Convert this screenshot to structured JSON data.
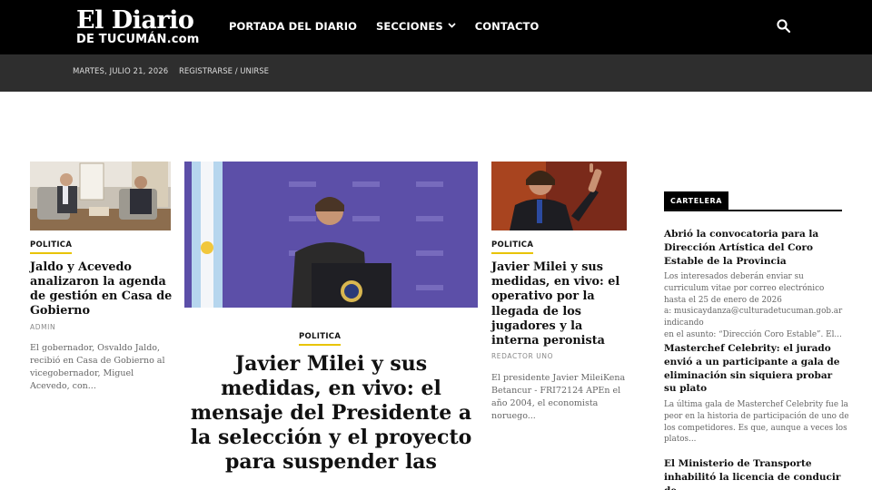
{
  "header": {
    "logo_main": "El Diario",
    "logo_sub": "DE TUCUMÁN.com",
    "nav": [
      {
        "label": "PORTADA DEL DIARIO"
      },
      {
        "label": "SECCIONES",
        "icon": "chevron-down-icon"
      },
      {
        "label": "CONTACTO"
      }
    ],
    "search_icon": "search-icon"
  },
  "subbar": {
    "date": "MARTES, JULIO 21, 2026",
    "login": "REGISTRARSE / UNIRSE"
  },
  "colors": {
    "header_bg": "#000000",
    "subbar_bg": "#2e2e2e",
    "category_underline": "#e8c400"
  },
  "articles": {
    "left": {
      "category": "POLITICA",
      "title": "Jaldo y Acevedo analizaron la agenda de gestión en Casa de Gobierno",
      "author": "ADMIN",
      "excerpt": "El gobernador, Osvaldo Jaldo, recibió en Casa de Gobierno al vicegobernador, Miguel Acevedo, con..."
    },
    "center": {
      "category": "POLITICA",
      "title": "Javier Milei y sus medidas, en vivo: el mensaje del Presidente a la selección y el proyecto para suspender las"
    },
    "right": {
      "category": "POLITICA",
      "title": "Javier Milei y sus medidas, en vivo: el operativo por la llegada de los jugadores y la interna peronista",
      "author": "REDACTOR UNO",
      "excerpt": "El presidente Javier MileiKena Betancur - FRI72124 APEn el año 2004, el economista noruego..."
    }
  },
  "cartelera": {
    "label": "CARTELERA",
    "items": [
      {
        "title": "Abrió la convocatoria para la Dirección Artística del Coro Estable de la Provincia",
        "text": "Los interesados deberán enviar su\ncurriculum vitae por correo electrónico\nhasta el 25 de enero de 2026\na: musicaydanza@culturadetucuman.gob.ar indicando\nen el asunto: “Dirección Coro Estable”. El..."
      },
      {
        "title": "Masterchef Celebrity: el jurado envió a un participante a gala de eliminación sin siquiera probar su plato",
        "text": "La última gala de Masterchef Celebrity fue la\npeor en la historia de participación de uno de\nlos competidores. Es que, aunque a veces los\nplatos..."
      },
      {
        "title": "El Ministerio de Transporte inhabilitó la licencia de conducir de",
        "text": ""
      }
    ]
  }
}
